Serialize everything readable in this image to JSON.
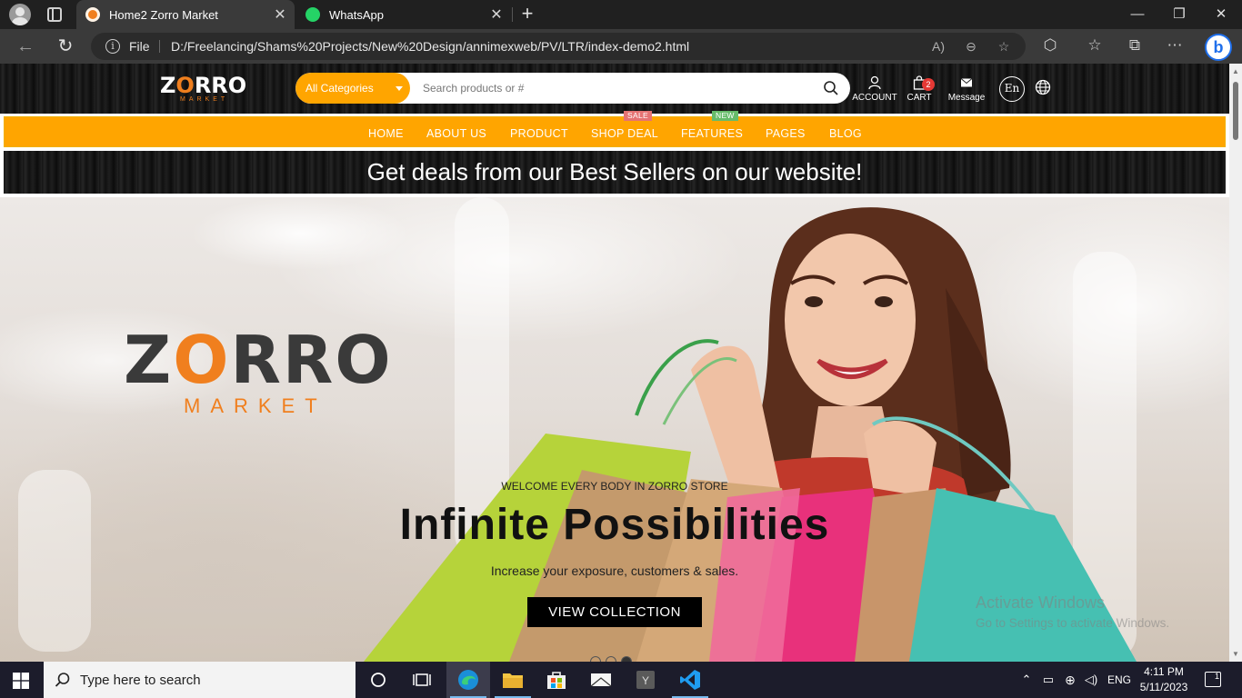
{
  "browser": {
    "tabs": [
      {
        "title": "Home2 Zorro Market",
        "active": true
      },
      {
        "title": "WhatsApp",
        "active": false
      }
    ],
    "protocol": "File",
    "url": "D:/Freelancing/Shams%20Projects/New%20Design/annimexweb/PV/LTR/index-demo2.html"
  },
  "site": {
    "logo": {
      "word_pre": "Z",
      "word_o": "O",
      "word_post": "RRO",
      "sub": "MARKET"
    },
    "search": {
      "category": "All Categories",
      "placeholder": "Search products or #"
    },
    "header_icons": {
      "account": "ACCOUNT",
      "cart": "CART",
      "cart_count": "2",
      "message": "Message",
      "language": "En"
    },
    "nav": [
      {
        "label": "HOME",
        "tag": ""
      },
      {
        "label": "ABOUT US",
        "tag": ""
      },
      {
        "label": "PRODUCT",
        "tag": ""
      },
      {
        "label": "SHOP DEAL",
        "tag": "SALE"
      },
      {
        "label": "FEATURES",
        "tag": "NEW"
      },
      {
        "label": "PAGES",
        "tag": ""
      },
      {
        "label": "BLOG",
        "tag": ""
      }
    ],
    "promo": "Get deals from our Best Sellers on our website!",
    "hero": {
      "logo_main_pre": "Z",
      "logo_main_o": "O",
      "logo_main_post": "RRO",
      "logo_sub": "MARKET",
      "subtitle": "WELCOME EVERY BODY IN ZORRO STORE",
      "title": "Infinite Possibilities",
      "description": "Increase your exposure, customers & sales.",
      "button": "VIEW COLLECTION",
      "slides": 3,
      "active_slide": 3
    },
    "watermark": {
      "line1": "Activate Windows",
      "line2": "Go to Settings to activate Windows."
    }
  },
  "taskbar": {
    "search_placeholder": "Type here to search",
    "language": "ENG",
    "time": "4:11 PM",
    "date": "5/11/2023",
    "notifications": "1"
  },
  "colors": {
    "accent": "#ffa500",
    "brand_orange": "#f07f1e",
    "sale": "#e57373",
    "new": "#66bb6a"
  }
}
